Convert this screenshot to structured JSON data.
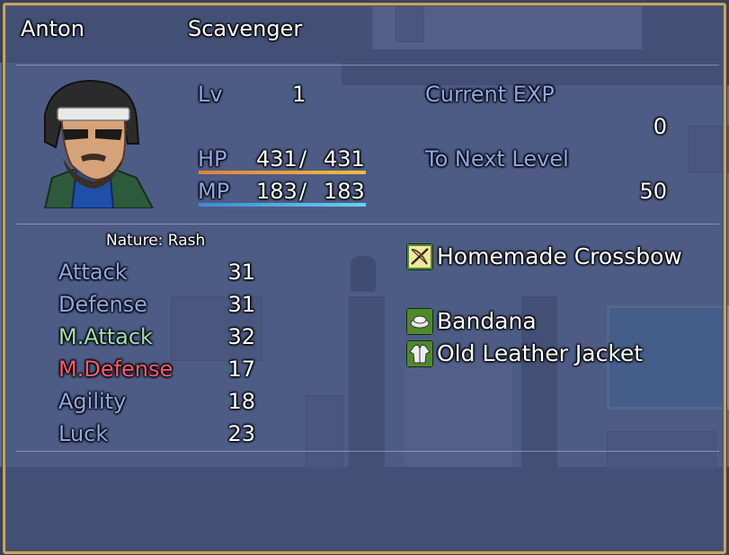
{
  "actor": {
    "name": "Anton",
    "class": "Scavenger",
    "nature": "Nature: Rash"
  },
  "level": {
    "label": "Lv",
    "value": "1"
  },
  "hp": {
    "label": "HP",
    "current": "431",
    "max": "431",
    "fill": 1.0,
    "color_from": "#e0803a",
    "color_to": "#f0c040"
  },
  "mp": {
    "label": "MP",
    "current": "183",
    "max": "183",
    "fill": 1.0,
    "color_from": "#3a8ad8",
    "color_to": "#6ad0f0"
  },
  "exp": {
    "current_label": "Current EXP",
    "current_value": "0",
    "next_label": "To Next Level",
    "next_value": "50"
  },
  "params": [
    {
      "label": "Attack",
      "value": "31",
      "color": "#8ea7e6"
    },
    {
      "label": "Defense",
      "value": "31",
      "color": "#8ea7e6"
    },
    {
      "label": "M.Attack",
      "value": "32",
      "color": "#9ee0b0"
    },
    {
      "label": "M.Defense",
      "value": "17",
      "color": "#ff5b6b"
    },
    {
      "label": "Agility",
      "value": "18",
      "color": "#8ea7e6"
    },
    {
      "label": "Luck",
      "value": "23",
      "color": "#8ea7e6"
    }
  ],
  "equipment": [
    {
      "name": "Homemade Crossbow",
      "icon": "crossbow-icon"
    },
    {
      "name": "",
      "icon": ""
    },
    {
      "name": "Bandana",
      "icon": "bandana-icon"
    },
    {
      "name": "Old Leather Jacket",
      "icon": "jacket-icon"
    }
  ],
  "colors": {
    "window_border": "#b9a577",
    "system_text": "#8ea7e6"
  }
}
